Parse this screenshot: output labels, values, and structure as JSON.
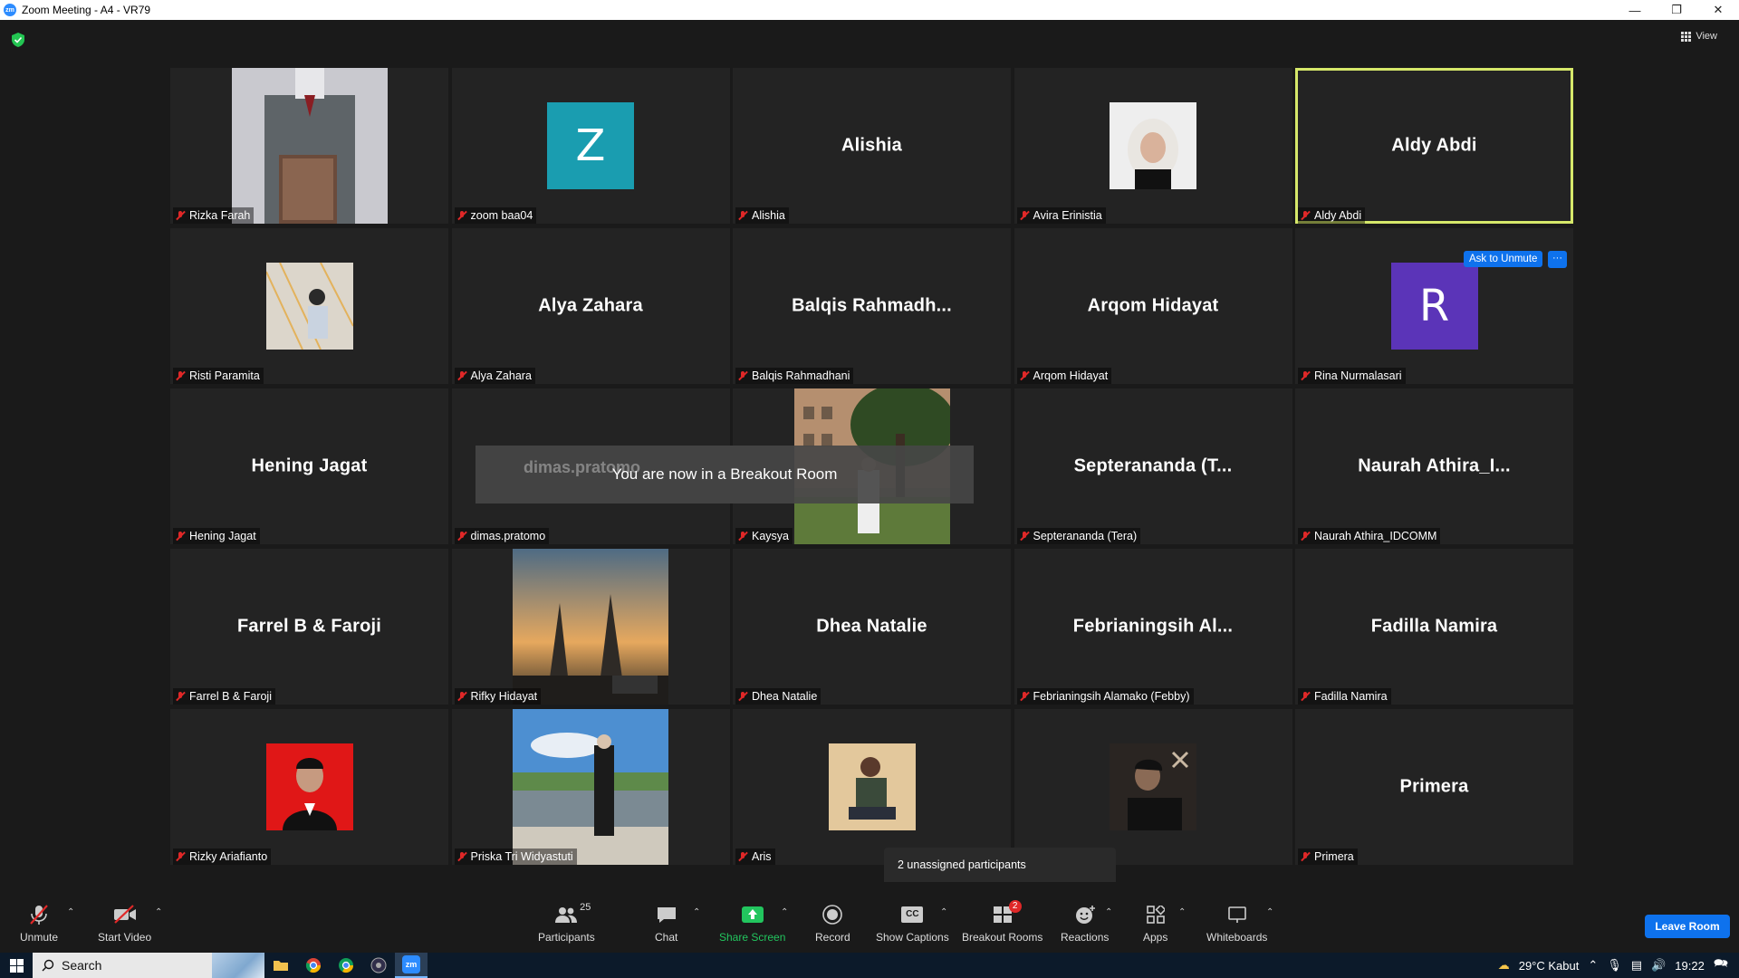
{
  "window": {
    "title": "Zoom Meeting - A4 - VR79"
  },
  "view": {
    "label": "View"
  },
  "tiles": [
    {
      "name": "Rizka Farah",
      "display": "",
      "kind": "photo",
      "photo": "book"
    },
    {
      "name": "zoom baa04",
      "display": "Z",
      "kind": "avatar",
      "color": "#1a9db0"
    },
    {
      "name": "Alishia",
      "display": "Alishia",
      "kind": "name"
    },
    {
      "name": "Avira Erinistia",
      "display": "",
      "kind": "photo",
      "photo": "hijab"
    },
    {
      "name": "Aldy Abdi",
      "display": "Aldy Abdi",
      "kind": "name",
      "active": true
    },
    {
      "name": "Risti Paramita",
      "display": "",
      "kind": "photo",
      "photo": "light"
    },
    {
      "name": "Alya Zahara",
      "display": "Alya Zahara",
      "kind": "name"
    },
    {
      "name": "Balqis Rahmadhani",
      "display": "Balqis  Rahmadh...",
      "kind": "name"
    },
    {
      "name": "Arqom Hidayat",
      "display": "Arqom Hidayat",
      "kind": "name"
    },
    {
      "name": "Rina Nurmalasari",
      "display": "R",
      "kind": "avatar",
      "color": "#5b34b8"
    },
    {
      "name": "Hening Jagat",
      "display": "Hening Jagat",
      "kind": "name"
    },
    {
      "name": "dimas.pratomo",
      "display": "",
      "kind": "blank"
    },
    {
      "name": "Kaysya",
      "display": "",
      "kind": "photo",
      "photo": "tree"
    },
    {
      "name": "Septerananda (Tera)",
      "display": "Septerananda  (T...",
      "kind": "name"
    },
    {
      "name": "Naurah Athira_IDCOMM",
      "display": "Naurah  Athira_I...",
      "kind": "name"
    },
    {
      "name": "Farrel B & Faroji",
      "display": "Farrel B & Faroji",
      "kind": "name"
    },
    {
      "name": "Rifky Hidayat",
      "display": "",
      "kind": "photo",
      "photo": "temple"
    },
    {
      "name": "Dhea Natalie",
      "display": "Dhea Natalie",
      "kind": "name"
    },
    {
      "name": "Febrianingsih Alamako (Febby)",
      "display": "Febrianingsih  Al...",
      "kind": "name"
    },
    {
      "name": "Fadilla Namira",
      "display": "Fadilla Namira",
      "kind": "name"
    },
    {
      "name": "Rizky Ariafianto",
      "display": "",
      "kind": "photo",
      "photo": "redbg"
    },
    {
      "name": "Priska Tri Widyastuti",
      "display": "",
      "kind": "photo",
      "photo": "sky"
    },
    {
      "name": "Aris",
      "display": "",
      "kind": "photo",
      "photo": "sitting"
    },
    {
      "name": "",
      "display": "",
      "kind": "photo",
      "photo": "dark"
    },
    {
      "name": "Primera",
      "display": "Primera",
      "kind": "name"
    }
  ],
  "overlay": {
    "ask_unmute": "Ask to Unmute",
    "more": "···",
    "toast": "You are now in a Breakout Room",
    "toast_ghost": "dimas.pratomo",
    "unassigned": "2 unassigned participants"
  },
  "toolbar": {
    "unmute": "Unmute",
    "start_video": "Start Video",
    "participants": "Participants",
    "participants_count": "25",
    "chat": "Chat",
    "share_screen": "Share Screen",
    "record": "Record",
    "show_captions": "Show Captions",
    "breakout_rooms": "Breakout Rooms",
    "breakout_badge": "2",
    "reactions": "Reactions",
    "apps": "Apps",
    "whiteboards": "Whiteboards",
    "leave_room": "Leave Room",
    "cc": "CC"
  },
  "taskbar": {
    "search": "Search",
    "weather": "29°C  Kabut",
    "time": "19:22"
  },
  "colors": {
    "accent": "#0e72ed",
    "active_speaker": "#d6e86a",
    "muted": "#e02828",
    "share": "#22c55e"
  }
}
